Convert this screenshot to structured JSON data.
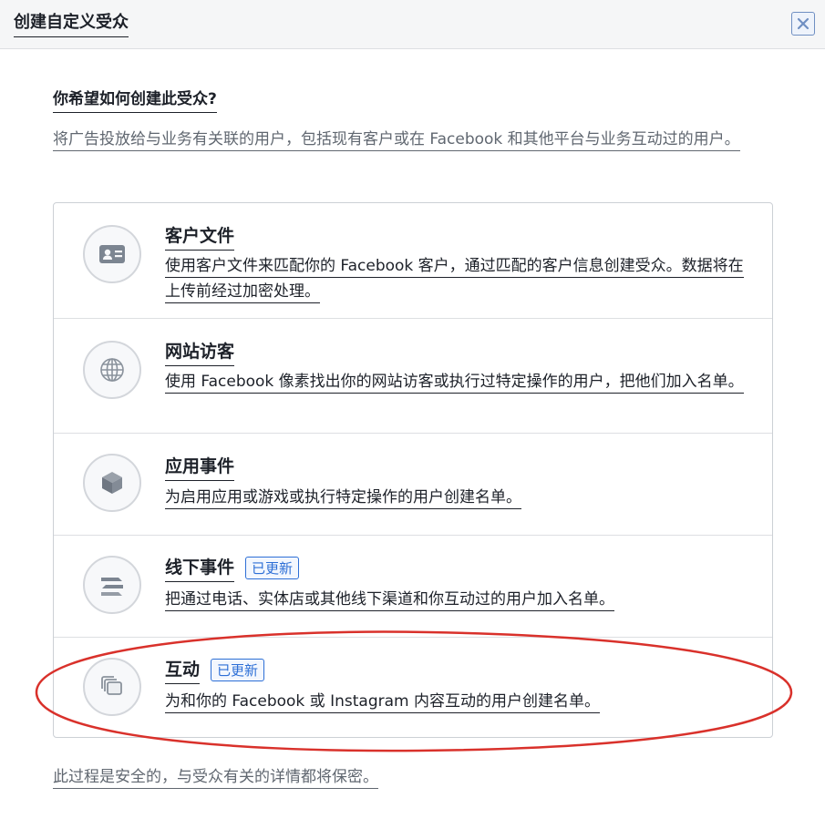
{
  "dialog": {
    "title": "创建自定义受众",
    "close_icon": "close-icon"
  },
  "question": "你希望如何创建此受众?",
  "intro": "将广告投放给与业务有关联的用户，包括现有客户或在 Facebook 和其他平台与业务互动过的用户。",
  "options": [
    {
      "title": "客户文件",
      "badge": "",
      "description": "使用客户文件来匹配你的 Facebook 客户，通过匹配的客户信息创建受众。数据将在上传前经过加密处理。",
      "icon": "contact-card-icon"
    },
    {
      "title": "网站访客",
      "badge": "",
      "description": "使用 Facebook 像素找出你的网站访客或执行过特定操作的用户，把他们加入名单。",
      "icon": "globe-icon"
    },
    {
      "title": "应用事件",
      "badge": "",
      "description": "为启用应用或游戏或执行特定操作的用户创建名单。",
      "icon": "cube-icon"
    },
    {
      "title": "线下事件",
      "badge": "已更新",
      "description": "把通过电话、实体店或其他线下渠道和你互动过的用户加入名单。",
      "icon": "offline-sync-icon"
    },
    {
      "title": "互动",
      "badge": "已更新",
      "description": "为和你的 Facebook 或 Instagram 内容互动的用户创建名单。",
      "icon": "stacked-cards-icon"
    }
  ],
  "footer_note": "此过程是安全的，与受众有关的详情都将保密。",
  "colors": {
    "accent": "#2d6fd6",
    "highlight": "#d9312b",
    "muted_text": "#606770"
  }
}
